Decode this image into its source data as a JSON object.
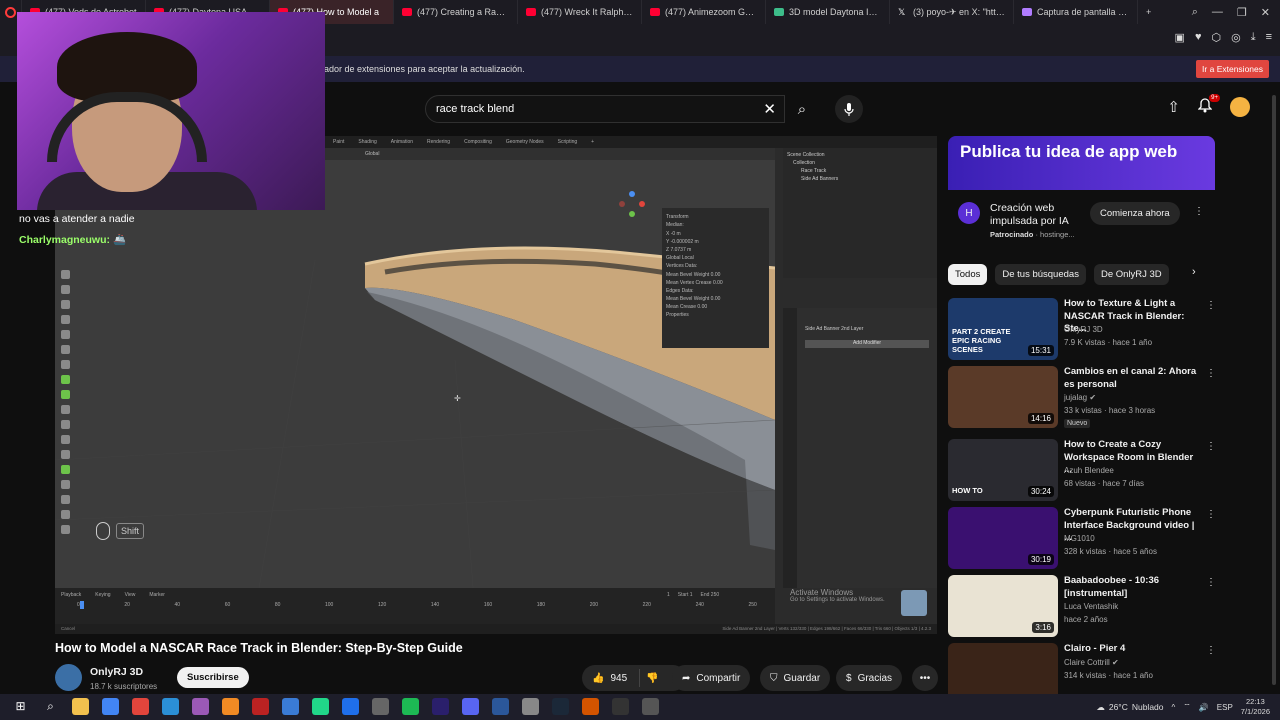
{
  "browser": {
    "tabs": [
      {
        "label": "(477) Vods de Astrobot",
        "fav": "yt"
      },
      {
        "label": "(477) Daytona USA Loop",
        "fav": "yt"
      },
      {
        "label": "(477) How to Model a",
        "fav": "yt",
        "active": true
      },
      {
        "label": "(477) Creating a Race Tr",
        "fav": "yt"
      },
      {
        "label": "(477) Wreck It Ralph - Ve",
        "fav": "yt"
      },
      {
        "label": "(477) Animezoom Green",
        "fav": "yt"
      },
      {
        "label": "3D model Daytona Intern",
        "fav": "g"
      },
      {
        "label": "(3) poyo-✈ en X: \"https:/",
        "fav": "x"
      },
      {
        "label": "Captura de pantalla por L",
        "fav": "p"
      }
    ],
    "new_tab": "+",
    "infobar_text": "ador de extensiones para aceptar la actualización.",
    "infobar_button": "Ir a Extensiones"
  },
  "header": {
    "search_value": "race track blend",
    "clear_icon": "✕",
    "search_icon": "⌕",
    "mic_icon": "🎤",
    "upload_icon": "⇧",
    "bell_icon": "🔔",
    "notif_count": "9+"
  },
  "chat": {
    "line1": "no vas a atender a nadie",
    "user": "Charlymagneuwu:",
    "msg": "🚢"
  },
  "video": {
    "blender_menu": [
      "Paint",
      "Shading",
      "Animation",
      "Rendering",
      "Compositing",
      "Geometry Nodes",
      "Scripting",
      "+"
    ],
    "viewport_header": "Global",
    "npanel": [
      "Transform",
      "Median:",
      "X -0 m",
      "Y -0.000002 m",
      "Z 7.0737 m",
      "Global   Local",
      "Vertices Data:",
      "Mean Bevel Weight 0.00",
      "Mean Vertex Crease 0.00",
      "Edges Data:",
      "Mean Bevel Weight 0.00",
      "Mean Crease 0.00",
      "Properties"
    ],
    "outliner_title": "Scene Collection",
    "outliner_items": [
      "Collection",
      "Race Track",
      "Side Ad Banners"
    ],
    "props_object": "Side Ad Banner 2nd Layer",
    "props_add": "Add Modifier",
    "timeline_menu": [
      "Playback",
      "Keying",
      "View",
      "Marker"
    ],
    "timeline_ticks": [
      "0",
      "20",
      "40",
      "60",
      "80",
      "100",
      "120",
      "140",
      "160",
      "180",
      "200",
      "220",
      "240",
      "250"
    ],
    "frame": "1",
    "start": "Start 1",
    "end": "End 250",
    "status": "Cancel",
    "status_right": "Side Ad Banner 2nd Layer | Verts 132/330 | Edges 198/662 | Faces 66/330 | Tris 660 | Objects 1/3 | 4.2.3",
    "activate_title": "Activate Windows",
    "activate_sub": "Go to Settings to activate Windows.",
    "shift_key": "Shift"
  },
  "meta": {
    "title": "How to Model a NASCAR Race Track in Blender: Step-By-Step Guide",
    "channel": "OnlyRJ 3D",
    "subscribers": "18.7 k suscriptores",
    "subscribe": "Suscribirse",
    "likes": "945",
    "share": "Compartir",
    "save": "Guardar",
    "thanks": "Gracias"
  },
  "ad": {
    "headline": "Publica tu idea de app web",
    "title": "Creación web impulsada por IA",
    "sponsored": "Patrocinado",
    "advertiser": "· hostinge...",
    "cta": "Comienza ahora"
  },
  "chips": [
    "Todos",
    "De tus búsquedas",
    "De OnlyRJ 3D"
  ],
  "recommendations": [
    {
      "title": "How to Texture & Light a NASCAR Track in Blender: Ste...",
      "channel": "OnlyRJ 3D",
      "meta": "7.9 K vistas · hace 1 año",
      "duration": "15:31",
      "thumb_text": "PART 2 CREATE EPIC RACING SCENES",
      "color": "#1d3a6b"
    },
    {
      "title": "Cambios en el canal 2: Ahora es personal",
      "channel": "jujalag ✔",
      "meta": "33 k vistas · hace 3 horas",
      "badge": "Nuevo",
      "duration": "14:16",
      "color": "#5a3a28"
    },
    {
      "title": "How to Create a Cozy Workspace Room in Blender ...",
      "channel": "Azuh Blendee",
      "meta": "68 vistas · hace 7 días",
      "duration": "30:24",
      "thumb_text": "HOW TO",
      "color": "#2a2a30"
    },
    {
      "title": "Cyberpunk Futuristic Phone Interface Background video | ...",
      "channel": "MG1010",
      "meta": "328 k vistas · hace 5 años",
      "duration": "30:19",
      "color": "#3a1070"
    },
    {
      "title": "Baabadoobee - 10:36 [instrumental]",
      "channel": "Luca Ventashik",
      "meta": "hace 2 años",
      "duration": "3:16",
      "color": "#e9e3d3"
    },
    {
      "title": "Clairo - Pier 4",
      "channel": "Claire Cottrill ✔",
      "meta": "314 k vistas · hace 1 año",
      "color": "#3a2418"
    }
  ],
  "taskbar": {
    "temp": "26°C",
    "weather": "Nublado",
    "lang": "ESP",
    "time": "22:13",
    "date": "7/1/2026"
  }
}
